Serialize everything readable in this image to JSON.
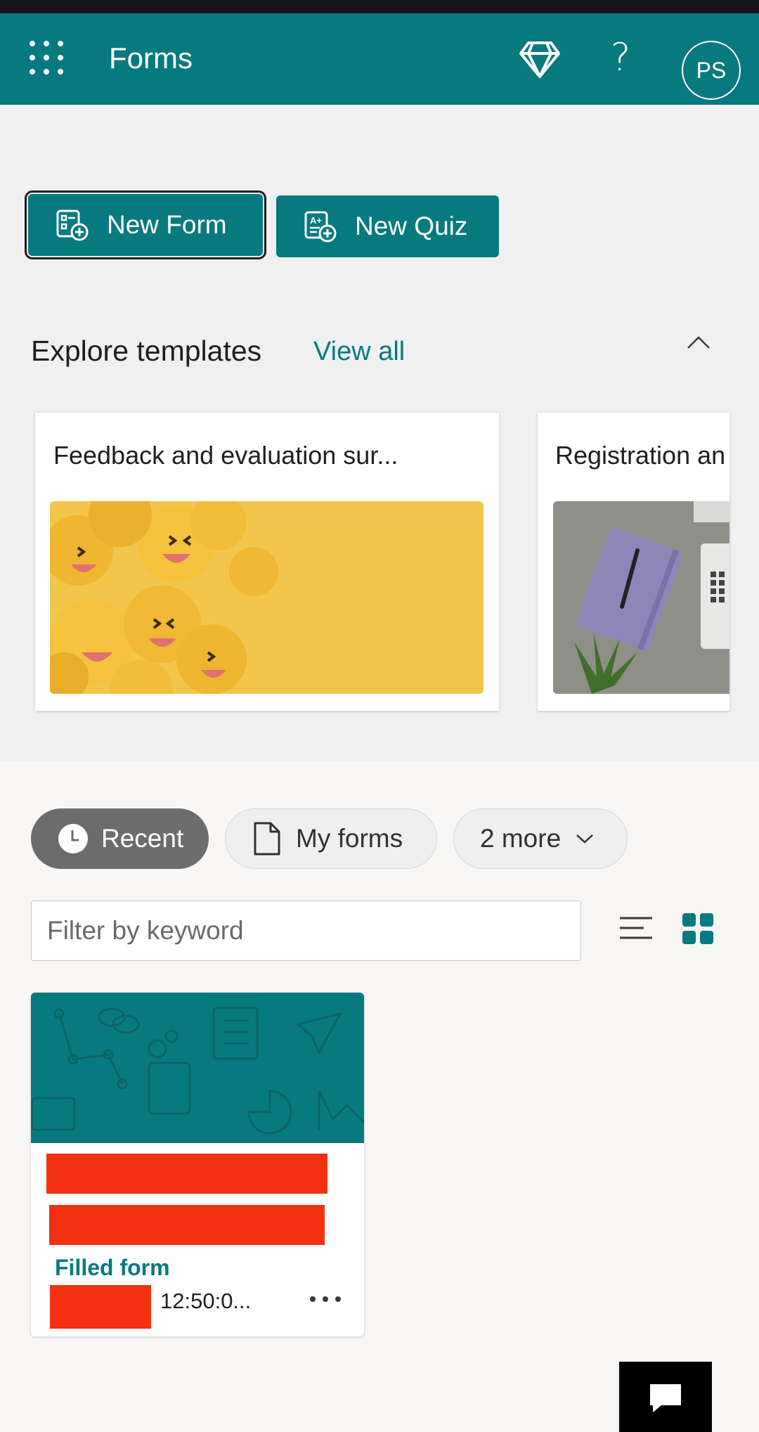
{
  "header": {
    "app_title": "Forms",
    "avatar_initials": "PS",
    "help_glyph": "?",
    "icons": [
      "waffle-icon",
      "diamond-icon",
      "help-icon"
    ],
    "color": "#077a7f"
  },
  "actions": {
    "new_form": "New Form",
    "new_quiz": "New Quiz"
  },
  "templates": {
    "title": "Explore templates",
    "view_all": "View all",
    "items": [
      {
        "name": "Feedback and evaluation sur...",
        "image": "laughing-emoji-balls"
      },
      {
        "name": "Registration an",
        "image": "notebook-and-laptop"
      }
    ]
  },
  "filters": {
    "pills": [
      {
        "label": "Recent",
        "icon": "clock-icon",
        "selected": true
      },
      {
        "label": "My forms",
        "icon": "document-icon",
        "selected": false
      },
      {
        "label": "2 more",
        "icon": "chevron-down-icon",
        "selected": false
      }
    ],
    "search_placeholder": "Filter by keyword",
    "view_mode": "grid"
  },
  "forms": [
    {
      "status": "Filled form",
      "time": "12:50:0...",
      "title_redacted": true
    }
  ],
  "colors": {
    "accent": "#077a7f",
    "redaction": "#f23112",
    "page_bg": "#f9f7f5",
    "top_bg": "#f0f0f0"
  }
}
